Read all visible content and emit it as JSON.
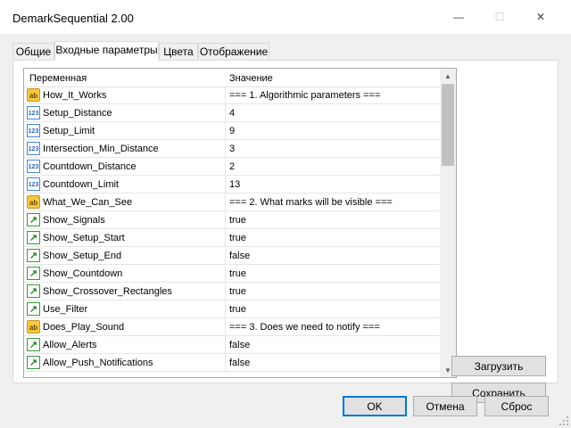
{
  "window": {
    "title": "DemarkSequential 2.00",
    "minimize": "—",
    "maximize": "☐",
    "close": "✕"
  },
  "tabs": [
    {
      "label": "Общие",
      "active": false
    },
    {
      "label": "Входные параметры",
      "active": true
    },
    {
      "label": "Цвета",
      "active": false
    },
    {
      "label": "Отображение",
      "active": false
    }
  ],
  "grid": {
    "col_variable": "Переменная",
    "col_value": "Значение",
    "rows": [
      {
        "type": "ab",
        "name": "How_It_Works",
        "value": "=== 1. Algorithmic parameters ==="
      },
      {
        "type": "num",
        "name": "Setup_Distance",
        "value": "4"
      },
      {
        "type": "num",
        "name": "Setup_Limit",
        "value": "9"
      },
      {
        "type": "num",
        "name": "Intersection_Min_Distance",
        "value": "3"
      },
      {
        "type": "num",
        "name": "Countdown_Distance",
        "value": "2"
      },
      {
        "type": "num",
        "name": "Countdown_Limit",
        "value": "13"
      },
      {
        "type": "ab",
        "name": "What_We_Can_See",
        "value": "=== 2. What marks will be visible ==="
      },
      {
        "type": "bool",
        "name": "Show_Signals",
        "value": "true"
      },
      {
        "type": "bool",
        "name": "Show_Setup_Start",
        "value": "true"
      },
      {
        "type": "bool",
        "name": "Show_Setup_End",
        "value": "false"
      },
      {
        "type": "bool",
        "name": "Show_Countdown",
        "value": "true"
      },
      {
        "type": "bool",
        "name": "Show_Crossover_Rectangles",
        "value": "true"
      },
      {
        "type": "bool",
        "name": "Use_Filter",
        "value": "true"
      },
      {
        "type": "ab",
        "name": "Does_Play_Sound",
        "value": "=== 3. Does we need to notify ==="
      },
      {
        "type": "bool",
        "name": "Allow_Alerts",
        "value": "false"
      },
      {
        "type": "bool",
        "name": "Allow_Push_Notifications",
        "value": "false"
      }
    ]
  },
  "icons": {
    "ab": "ab",
    "num": "123",
    "bool": "↗"
  },
  "side_buttons": {
    "load": "Загрузить",
    "save": "Сохранить"
  },
  "footer": {
    "ok": "OK",
    "cancel": "Отмена",
    "reset": "Сброс"
  },
  "colors": {
    "accent": "#0078d7",
    "dialog_bg": "#f0f0f0"
  }
}
